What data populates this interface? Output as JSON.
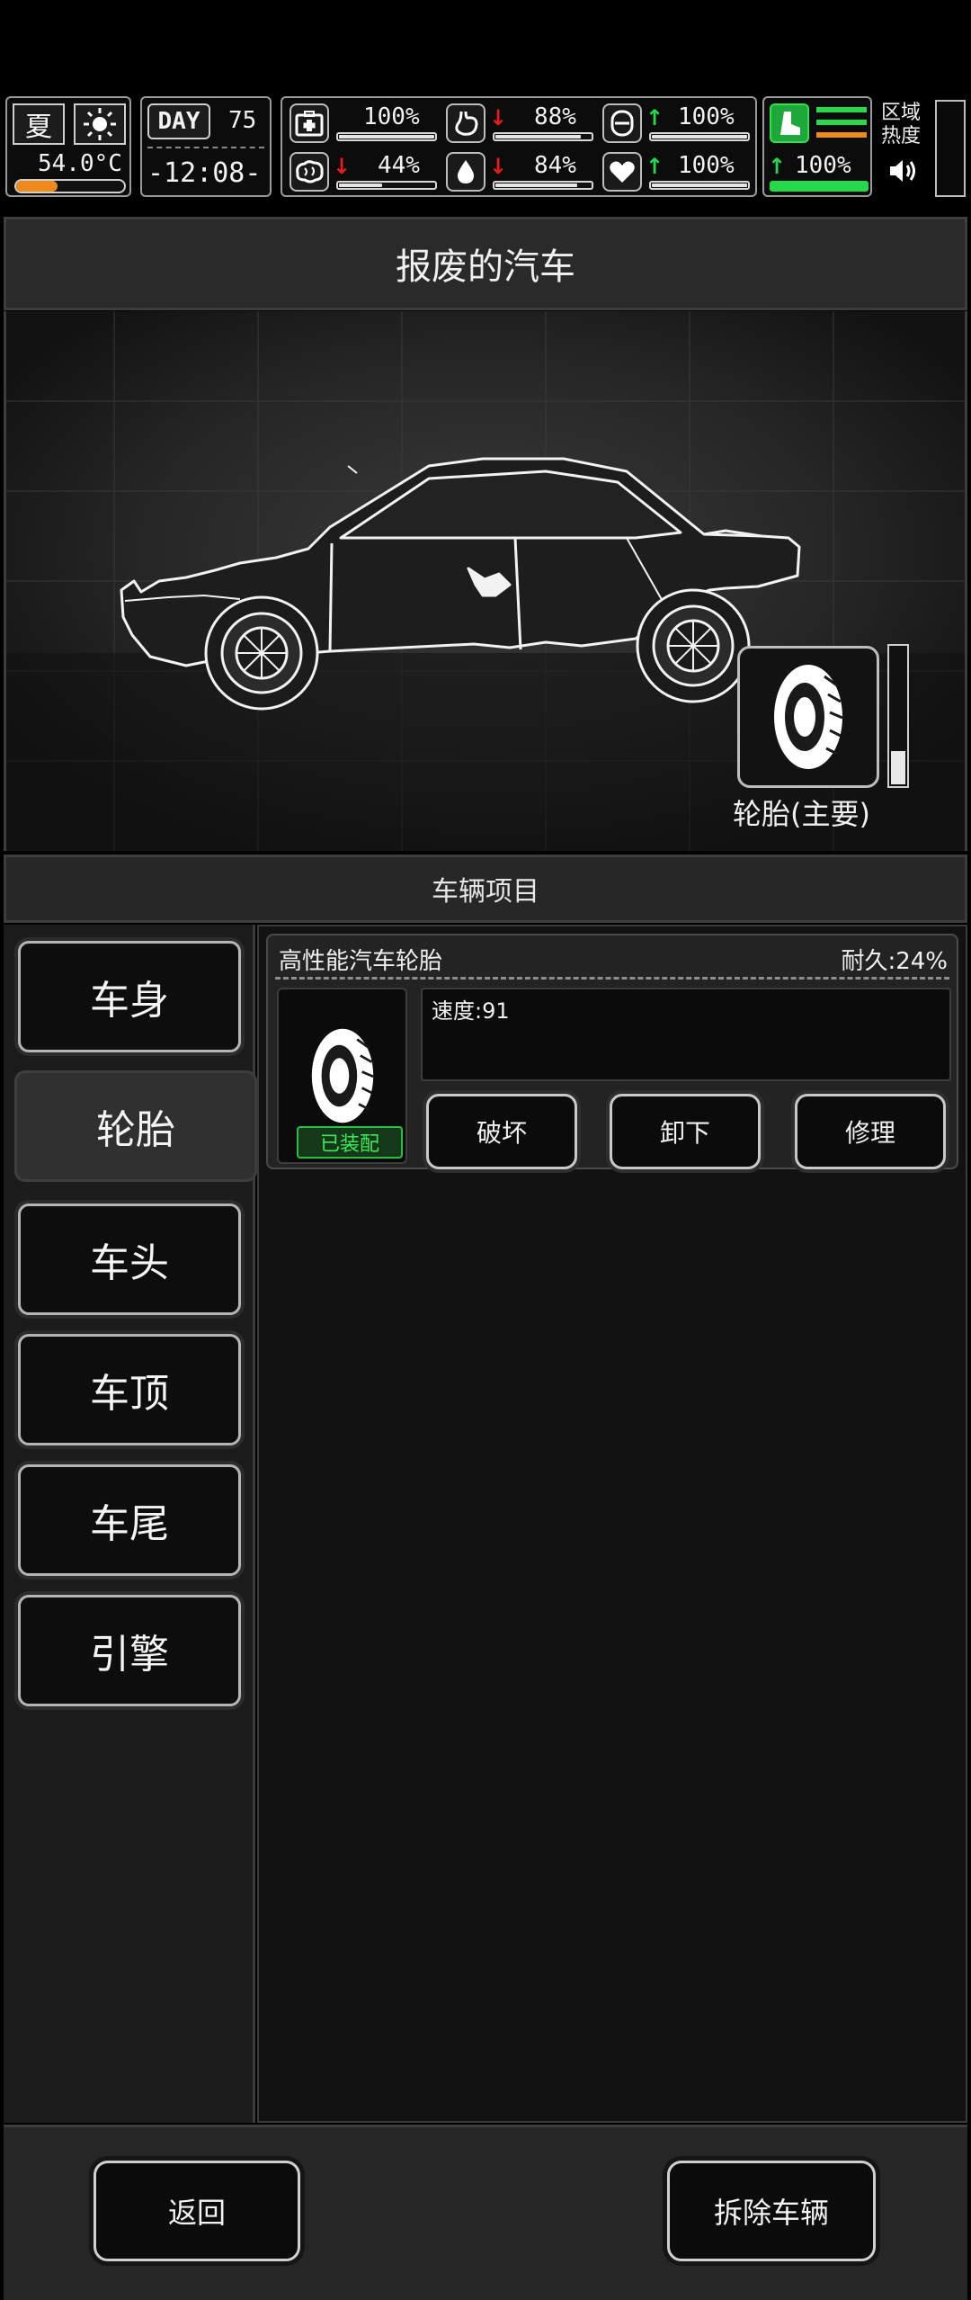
{
  "hud": {
    "season": "夏",
    "temperature": "54.0°C",
    "day_label": "DAY",
    "day_number": "75",
    "time": "-12:08-",
    "stats": [
      {
        "icon": "medkit-icon",
        "value": "100%",
        "trend": "",
        "fill": 1.0
      },
      {
        "icon": "stomach-icon",
        "value": "88%",
        "trend": "down",
        "fill": 0.88
      },
      {
        "icon": "shield-icon",
        "value": "100%",
        "trend": "up",
        "fill": 1.0
      },
      {
        "icon": "brain-icon",
        "value": "44%",
        "trend": "down",
        "fill": 0.44
      },
      {
        "icon": "water-drop-icon",
        "value": "84%",
        "trend": "down",
        "fill": 0.84
      },
      {
        "icon": "heart-icon",
        "value": "100%",
        "trend": "up",
        "fill": 1.0
      }
    ],
    "stamina_value": "100%",
    "stamina_trend": "up",
    "zone_heat_label": "区域热度",
    "colors": {
      "green": "#26d94a",
      "red": "#e61c1c",
      "orange": "#f08a1c"
    }
  },
  "title": "报废的汽车",
  "slot_label": "轮胎(主要)",
  "slot_durability": 0.24,
  "section_title": "车辆项目",
  "categories": [
    "车身",
    "轮胎",
    "车头",
    "车顶",
    "车尾",
    "引擎"
  ],
  "active_category": "轮胎",
  "item": {
    "name": "高性能汽车轮胎",
    "durability": "耐久:24%",
    "equipped_label": "已装配",
    "stats_text": "速度:91",
    "actions": {
      "destroy": "破坏",
      "unequip": "卸下",
      "repair": "修理"
    }
  },
  "footer": {
    "back": "返回",
    "dismantle": "拆除车辆"
  }
}
